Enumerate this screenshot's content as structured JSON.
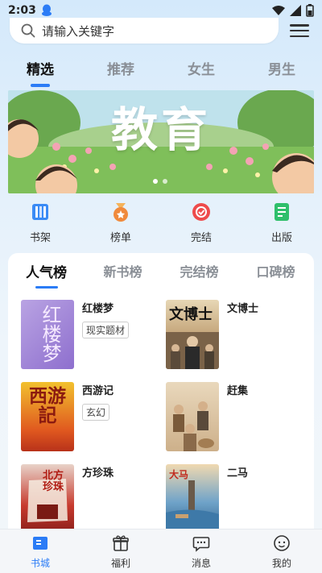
{
  "status": {
    "time": "2:03"
  },
  "search": {
    "placeholder": "请输入关键字"
  },
  "top_tabs": [
    {
      "label": "精选",
      "active": true
    },
    {
      "label": "推荐",
      "active": false
    },
    {
      "label": "女生",
      "active": false
    },
    {
      "label": "男生",
      "active": false
    }
  ],
  "banner": {
    "title": "教育"
  },
  "quick_nav": [
    {
      "label": "书架",
      "icon": "bookshelf-icon",
      "color": "#3a8bf5"
    },
    {
      "label": "榜单",
      "icon": "medal-icon",
      "color": "#f08a3c"
    },
    {
      "label": "完结",
      "icon": "badge-icon",
      "color": "#ee4b4b"
    },
    {
      "label": "出版",
      "icon": "publish-icon",
      "color": "#2fbf6b"
    }
  ],
  "rank_tabs": [
    {
      "label": "人气榜",
      "active": true
    },
    {
      "label": "新书榜",
      "active": false
    },
    {
      "label": "完结榜",
      "active": false
    },
    {
      "label": "口碑榜",
      "active": false
    }
  ],
  "books": [
    {
      "title": "红楼梦",
      "tag": "现实题材",
      "cover_text": "红楼梦"
    },
    {
      "title": "文博士",
      "tag": "",
      "cover_text": "文博士"
    },
    {
      "title": "西游记",
      "tag": "玄幻",
      "cover_text": "西游記"
    },
    {
      "title": "赶集",
      "tag": "",
      "cover_text": ""
    },
    {
      "title": "方珍珠",
      "tag": "",
      "cover_text": "北方珍珠"
    },
    {
      "title": "二马",
      "tag": "",
      "cover_text": "大马"
    }
  ],
  "bottom_nav": [
    {
      "label": "书城",
      "icon": "book-city-icon",
      "active": true
    },
    {
      "label": "福利",
      "icon": "gift-icon",
      "active": false
    },
    {
      "label": "消息",
      "icon": "message-icon",
      "active": false
    },
    {
      "label": "我的",
      "icon": "profile-icon",
      "active": false
    }
  ],
  "colors": {
    "accent": "#2b7cf6"
  }
}
